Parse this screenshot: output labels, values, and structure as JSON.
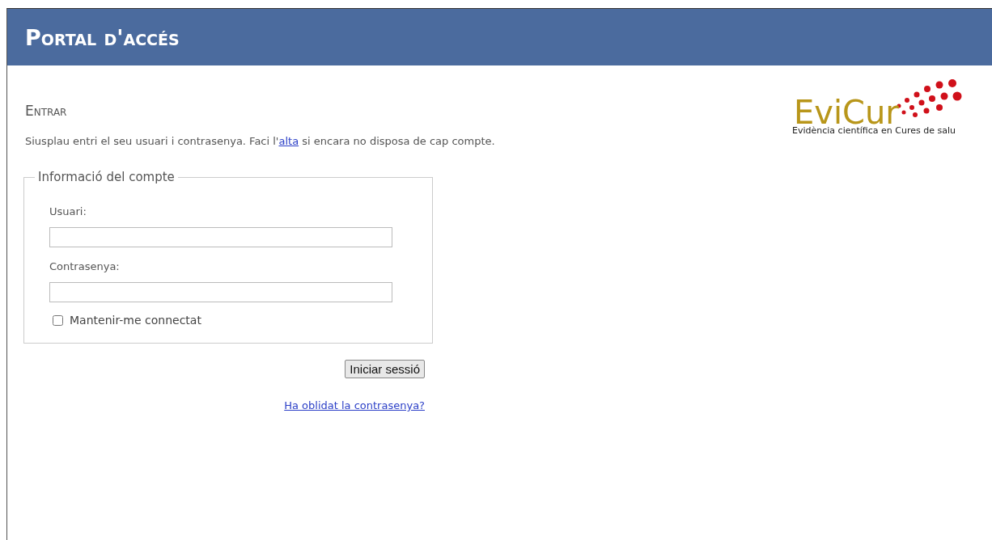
{
  "header": {
    "title": "Portal d'accés"
  },
  "section": {
    "title": "Entrar"
  },
  "intro": {
    "before": "Siusplau entri el seu usuari i contrasenya. Faci l'",
    "link": "alta",
    "after": " si encara no disposa de cap compte."
  },
  "logo": {
    "name": "EviCur",
    "tagline": "Evidència científica en Cures de salu"
  },
  "account_box": {
    "legend": "Informació del compte",
    "fields": [
      {
        "label": "Usuari:"
      },
      {
        "label": "Contrasenya:"
      }
    ],
    "remember": {
      "label": "Mantenir-me connectat",
      "checked": false
    }
  },
  "submit_button": "Iniciar sessió",
  "forgot_link": "Ha oblidat la contrasenya?"
}
